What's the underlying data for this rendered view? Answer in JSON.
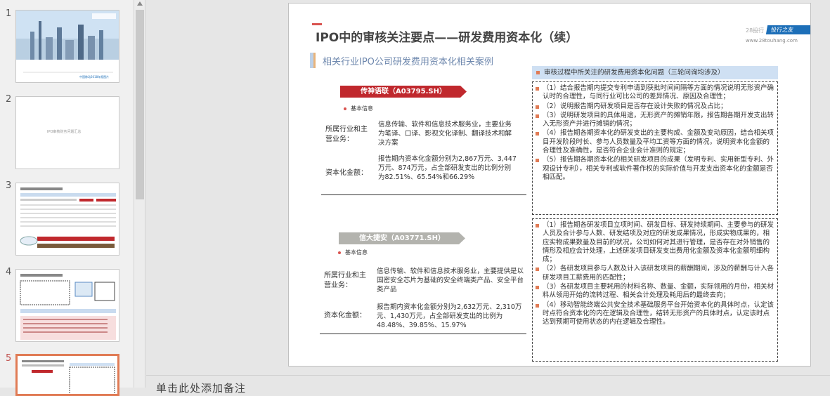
{
  "thumbnails": [
    {
      "num": "1",
      "caption": "中国移动2018年报图片"
    },
    {
      "num": "2",
      "caption": "IPO审核财务问题汇总"
    },
    {
      "num": "3"
    },
    {
      "num": "4"
    },
    {
      "num": "5"
    }
  ],
  "notes_placeholder": "单击此处添加备注",
  "slide": {
    "title": "IPO中的审核关注要点——研发费用资本化（续）",
    "subtitle": "相关行业IPO公司研发费用资本化相关案例",
    "logo": {
      "small": "28投行",
      "tag": "投行之友",
      "url": "www.28touhang.com"
    },
    "case1": {
      "banner": "传神语联（A03795.SH）",
      "basic_label": "基本信息",
      "industry_label": "所属行业和主营业务：",
      "industry_value": "信息传输、软件和信息技术服务业，主要业务为笔译、口译、影视文化译制、翻译技术和解决方案",
      "cap_label": "资本化金额：",
      "cap_value": "报告期内资本化金额分别为2,867万元、3,447万元、874万元，占全部研发支出的比例分别为82.51%、65.54%和66.29%"
    },
    "case2": {
      "banner": "信大捷安（A03771.SH）",
      "basic_label": "基本信息",
      "industry_label": "所属行业和主营业务：",
      "industry_value": "信息传输、软件和信息技术服务业，主要提供是以国密安全芯片为基础的安全终端类产品、安全平台类产品",
      "cap_label": "资本化金额：",
      "cap_value": "报告期内资本化金额分别为2,632万元、2,310万元、1,430万元，占全部研发支出的比例为48.48%、39.85%、15.97%"
    },
    "right_header": "审核过程中所关注的研发费用资本化问题（三轮问询均涉及）",
    "box1": [
      "（1）结合报告期内提交专利申请到获批时间间隔等方面的情况说明无形资产确认时的合理性，与同行业可比公司的差异情况、原因及合理性；",
      "（2）说明报告期内研发项目是否存在设计失败的情况及占比；",
      "（3）说明研发项目的具体用途，无形资产的摊销年限，报告期各期开发支出转入无形资产并进行摊销的情况；",
      "（4）报告期各期资本化的研发支出的主要构成、金额及变动原因，结合相关项目开发阶段时长、参与人员数量及平均工资等方面的情况，说明资本化金额的合理性及准确性，是否符合企业会计准则的规定；",
      "（5）报告期各期资本化的相关研发项目的成果（发明专利、实用新型专利、外观设计专利），相关专利或软件著作权的实际价值与开发支出资本化的金额是否相匹配。"
    ],
    "box2": [
      "（1）报告期各研发项目立项时间、研发目标、研发持续期间、主要参与的研发人员及合计参与人数、研发结项及对应的研发成果情况，形成实物成果的，相应实物成果数量及目前的状况，公司如何对其进行管理，是否存在对外销售的情形及相应会计处理，上述研发项目研发支出费用化金额及资本化金额明细构成；",
      "（2）各研发项目参与人数及计入该研发项目的薪酬期间，涉及的薪酬与计入各研发项目工薪费用的匹配性；",
      "（3）各研发项目主要耗用的材料名称、数量、金额，实际领用的月份，相关材料从领用开始的流转过程、相关会计处理及耗用后的最终去向；",
      "（4）移动智能终端公共安全技术基础服务平台开始资本化的具体时点，认定该时点符合资本化的内在逻辑及合理性，结转无形资产的具体时点，认定该时点达到预期可使用状态的内在逻辑及合理性。"
    ]
  },
  "colors": {
    "banner1": "#c0282d",
    "banner2": "#b3b3ae",
    "accent": "#e07b55",
    "header_bg": "#cfe0f3"
  }
}
